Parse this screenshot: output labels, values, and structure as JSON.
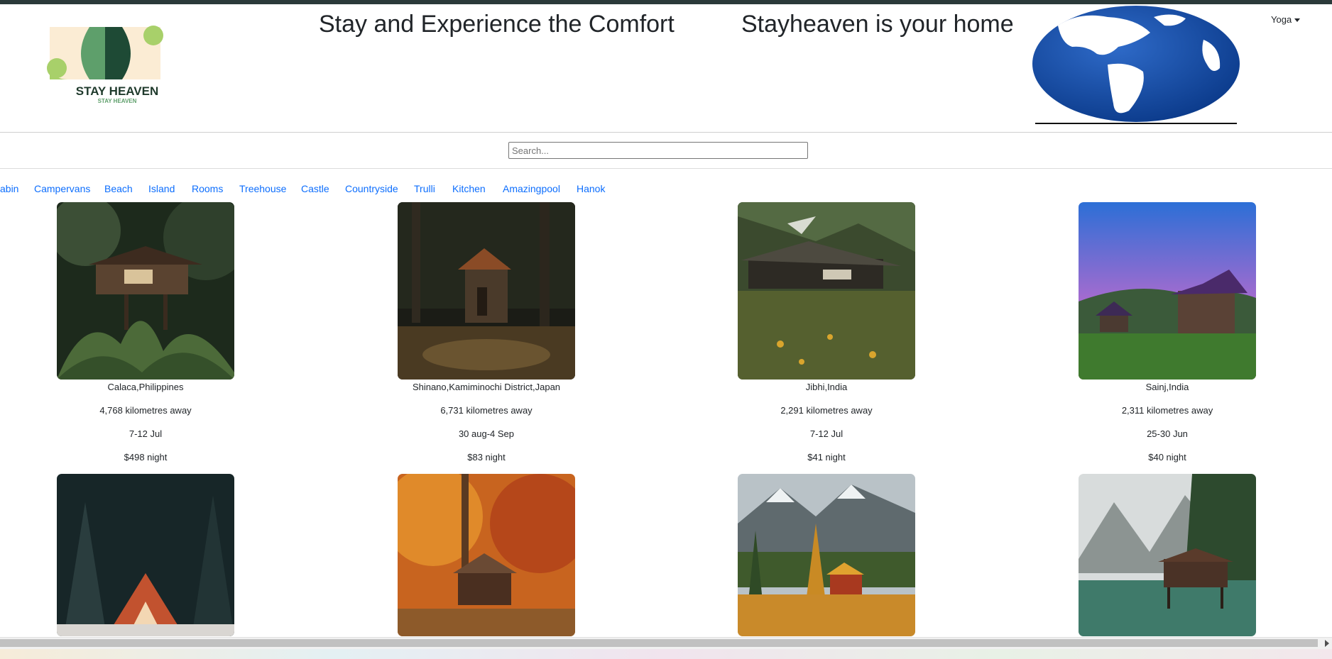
{
  "header": {
    "title_left": "Stay and Experience the Comfort",
    "title_right": "Stayheaven is your home",
    "logo_text": "STAY HEAVEN",
    "logo_subtext": "STAY HEAVEN",
    "user_menu": "Yoga"
  },
  "search": {
    "placeholder": "Search..."
  },
  "categories": [
    "abin",
    "Campervans",
    "Beach",
    "Island",
    "Rooms",
    "Treehouse",
    "Castle",
    "Countryside",
    "Trulli",
    "Kitchen",
    "Amazingpool",
    "Hanok"
  ],
  "listings": [
    {
      "location": "Calaca,Philippines",
      "distance": "4,768 kilometres away",
      "dates": "7-12 Jul",
      "price": "$498 night"
    },
    {
      "location": "Shinano,Kamiminochi District,Japan",
      "distance": "6,731 kilometres away",
      "dates": "30 aug-4 Sep",
      "price": "$83 night"
    },
    {
      "location": "Jibhi,India",
      "distance": "2,291 kilometres away",
      "dates": "7-12 Jul",
      "price": "$41 night"
    },
    {
      "location": "Sainj,India",
      "distance": "2,311 kilometres away",
      "dates": "25-30 Jun",
      "price": "$40 night"
    }
  ],
  "colors": {
    "link": "#0d6efd",
    "text": "#212529",
    "topbar": "#2b3a3a"
  },
  "icons": {
    "user_menu": "caret-down-icon",
    "scroll": "chevron-right-icon"
  }
}
